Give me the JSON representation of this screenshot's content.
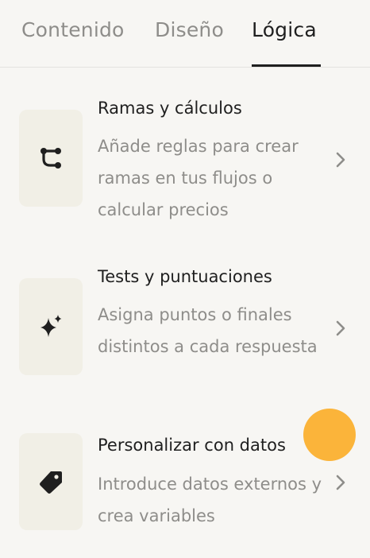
{
  "tabs": [
    {
      "label": "Contenido",
      "active": false
    },
    {
      "label": "Diseño",
      "active": false
    },
    {
      "label": "Lógica",
      "active": true
    }
  ],
  "items": [
    {
      "icon": "branch-icon",
      "title": "Ramas y cálculos",
      "description": "Añade reglas para crear ramas en tus flujos o calcular precios"
    },
    {
      "icon": "sparkle-icon",
      "title": "Tests y puntuaciones",
      "description": "Asigna puntos o finales distintos a cada respuesta"
    },
    {
      "icon": "tag-icon",
      "title": "Personalizar con datos",
      "description": "Introduce datos externos y crea variables"
    }
  ],
  "colors": {
    "background": "#f7f6f3",
    "tile": "#f1efe6",
    "text_primary": "#1f1f1f",
    "text_secondary": "#8e8d8a",
    "touch_indicator": "#fbb43a"
  }
}
